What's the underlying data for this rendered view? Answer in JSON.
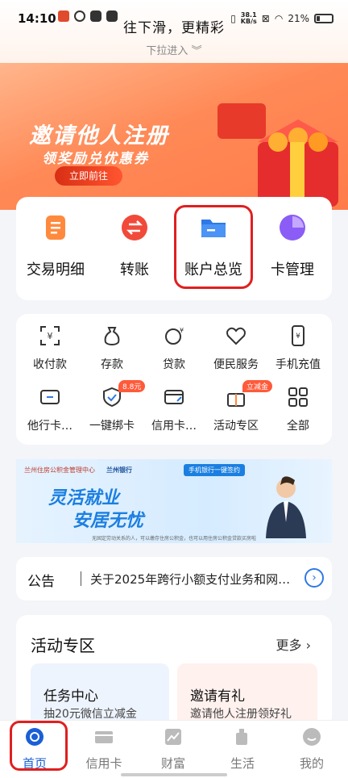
{
  "status": {
    "time": "14:10",
    "pull_title": "往下滑，更精彩",
    "pull_sub": "下拉进入",
    "net_speed": "38.1",
    "net_unit": "KB/s",
    "battery": "21%"
  },
  "banner": {
    "title": "邀请他人注册",
    "subtitle": "领奖励兑优惠券",
    "cta": "立即前往"
  },
  "quick": [
    {
      "label": "交易明细",
      "icon": "receipt-icon",
      "color": "#ff8a3d"
    },
    {
      "label": "转账",
      "icon": "transfer-icon",
      "color": "#f24a3a"
    },
    {
      "label": "账户总览",
      "icon": "folder-icon",
      "color": "#2e79e6"
    },
    {
      "label": "卡管理",
      "icon": "pie-icon",
      "color": "#8b5cf6"
    }
  ],
  "grid": [
    {
      "label": "收付款",
      "icon": "scan-yuan-icon"
    },
    {
      "label": "存款",
      "icon": "money-bag-icon"
    },
    {
      "label": "贷款",
      "icon": "coin-hand-icon"
    },
    {
      "label": "便民服务",
      "icon": "heart-icon"
    },
    {
      "label": "手机充值",
      "icon": "phone-icon"
    },
    {
      "label": "他行卡…",
      "icon": "card-in-icon"
    },
    {
      "label": "一键绑卡",
      "icon": "shield-icon",
      "badge": "8.8元"
    },
    {
      "label": "信用卡…",
      "icon": "credit-card-icon"
    },
    {
      "label": "活动专区",
      "icon": "gift-icon",
      "badge": "立减金"
    },
    {
      "label": "全部",
      "icon": "grid-icon"
    }
  ],
  "ad": {
    "org1": "兰州住房公积金管理中心",
    "org2": "兰州银行",
    "slogan1": "灵活就业",
    "slogan2": "安居无忧",
    "tag": "手机银行一键签约",
    "footnote": "无固定劳动关系的人，可以缴存住房公积金，也可以用住房公积金贷款买房啦"
  },
  "notice": {
    "tag": "公告",
    "text": "关于2025年跨行小额支付业务和网…"
  },
  "activity": {
    "title": "活动专区",
    "more": "更多 ›",
    "cards": [
      {
        "title": "任务中心",
        "sub": "抽20元微信立减金"
      },
      {
        "title": "邀请有礼",
        "sub": "邀请他人注册领好礼"
      }
    ]
  },
  "tabs": [
    {
      "label": "首页",
      "icon": "home-icon",
      "active": true
    },
    {
      "label": "信用卡",
      "icon": "credit-card-icon"
    },
    {
      "label": "财富",
      "icon": "chart-icon"
    },
    {
      "label": "生活",
      "icon": "cup-icon"
    },
    {
      "label": "我的",
      "icon": "user-icon"
    }
  ]
}
